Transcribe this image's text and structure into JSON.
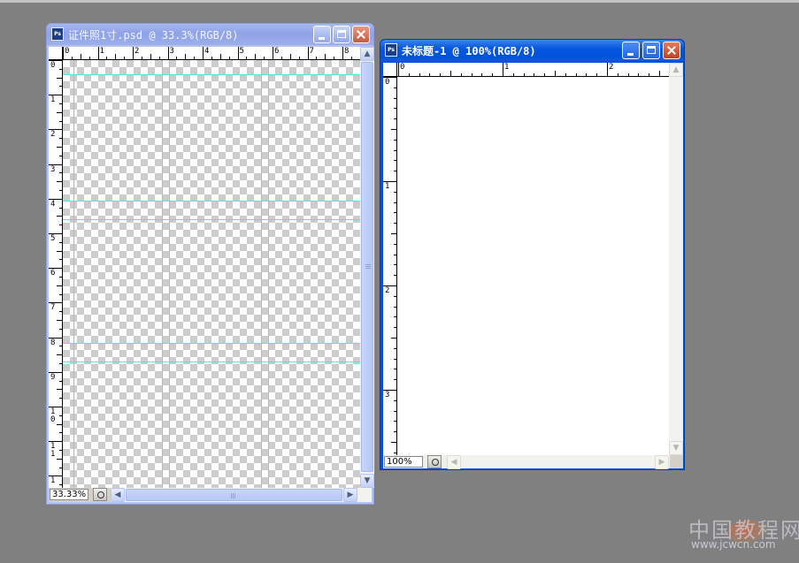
{
  "window1": {
    "title": "证件照1寸.psd @ 33.3%(RGB/8)",
    "icon_text": "Ps",
    "zoom": "33.33%",
    "hruler_labels": [
      "0",
      "1",
      "2",
      "3",
      "4",
      "5",
      "6",
      "7",
      "8"
    ],
    "vruler_labels": [
      "0",
      "1",
      "2",
      "3",
      "4",
      "5",
      "6",
      "7",
      "8",
      "9",
      "1\n0",
      "1\n1",
      "1"
    ]
  },
  "window2": {
    "title": "未标题-1 @ 100%(RGB/8)",
    "icon_text": "Ps",
    "zoom": "100%",
    "hruler_labels": [
      "0",
      "1",
      "2"
    ],
    "vruler_labels": [
      "0",
      "1",
      "2",
      "3"
    ]
  },
  "watermark": {
    "main": "中国教程网",
    "url": "www.jcwcn.com"
  },
  "icons": {
    "minimize": "minimize-icon",
    "maximize": "maximize-icon",
    "close": "close-icon",
    "scroll_up": "arrow-up-icon",
    "scroll_down": "arrow-down-icon",
    "scroll_left": "arrow-left-icon",
    "scroll_right": "arrow-right-icon"
  },
  "colors": {
    "guide": "#4fe6e0",
    "desktop": "#808080",
    "active_title": "#0052dc",
    "inactive_title": "#9aaaf0"
  }
}
